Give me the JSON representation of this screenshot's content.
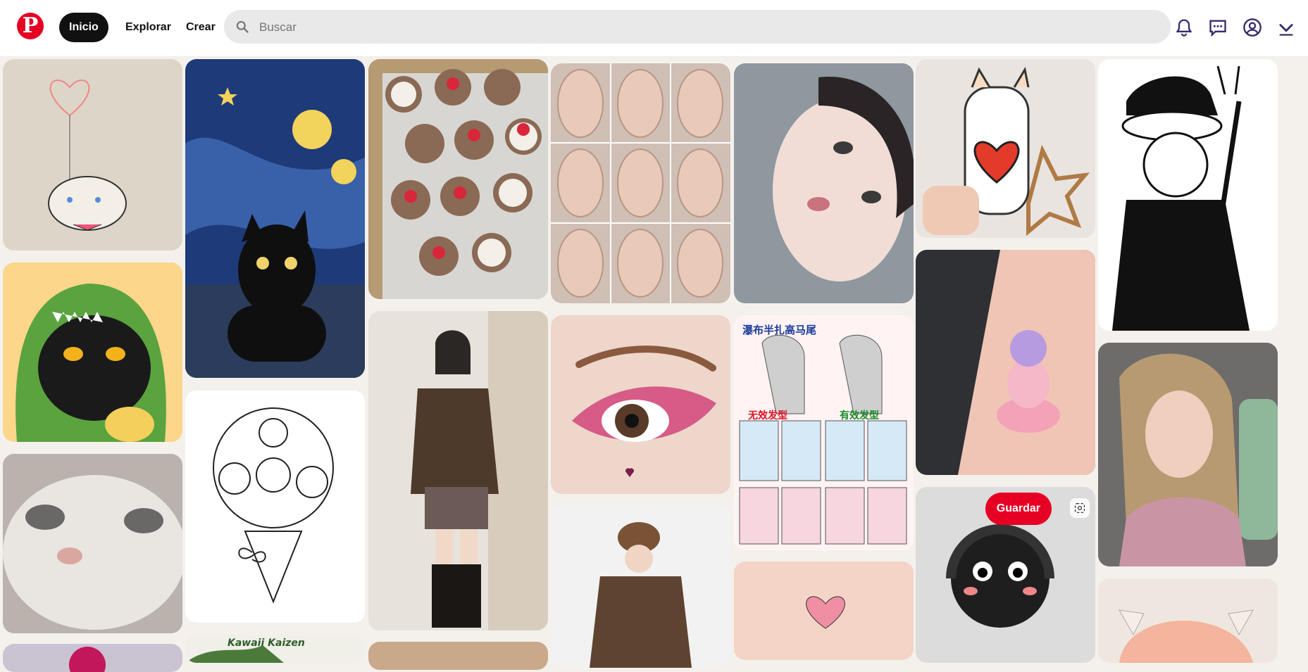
{
  "header": {
    "logo_letter": "P",
    "nav": {
      "home": "Inicio",
      "explore": "Explorar",
      "create": "Crear"
    },
    "search": {
      "placeholder": "Buscar",
      "value": ""
    },
    "icons": [
      "notifications-icon",
      "messages-icon",
      "account-icon",
      "chevron-down-icon"
    ]
  },
  "pins": {
    "hover_save_label": "Guardar",
    "hair_tutorial": {
      "title": "瀑布半扎高马尾",
      "bad_label": "无效发型",
      "good_label": "有效发型"
    },
    "bottom_col2_text": "Kawaii Kaizen"
  },
  "colors": {
    "brand": "#e60023",
    "nav_active_bg": "#111111",
    "search_bg": "#e9e9e9"
  }
}
